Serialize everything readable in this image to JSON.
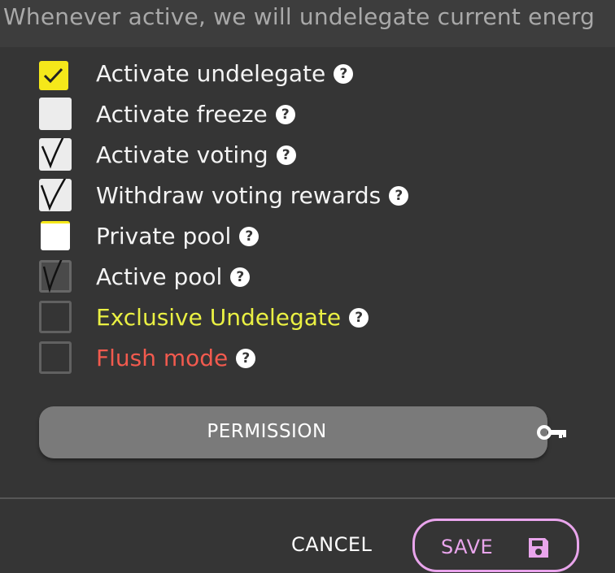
{
  "description_bar": {
    "text": "Whenever active, we will undelegate current energ"
  },
  "options": [
    {
      "label": "Activate undelegate",
      "state": "checked-yellow"
    },
    {
      "label": "Activate freeze",
      "state": "unchecked-light"
    },
    {
      "label": "Activate voting",
      "state": "hand-ticked"
    },
    {
      "label": "Withdraw voting rewards",
      "state": "hand-ticked"
    },
    {
      "label": "Private pool",
      "state": "unchecked-white"
    },
    {
      "label": "Active pool",
      "state": "hand-ticked-dim"
    },
    {
      "label": "Exclusive Undelegate",
      "state": "unchecked",
      "color": "#eaf043"
    },
    {
      "label": "Flush mode",
      "state": "unchecked",
      "color": "#f25a4e"
    }
  ],
  "help_glyph": "?",
  "permission_button": {
    "label": "PERMISSION",
    "icon": "key-icon"
  },
  "footer": {
    "cancel_label": "CANCEL",
    "save_label": "SAVE",
    "save_icon": "floppy-disk-icon",
    "save_color": "#e9a5ec"
  }
}
